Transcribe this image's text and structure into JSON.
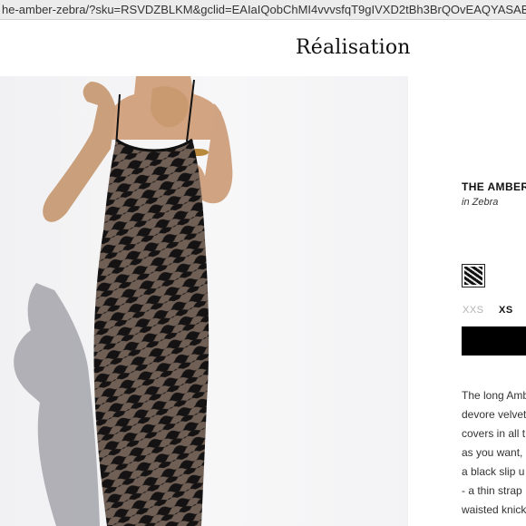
{
  "browser": {
    "url": "he-amber-zebra/?sku=RSVDZBLKM&gclid=EAIaIQobChMI4vvvsfqT9gIVXD2tBh3BrQOvEAQYASAB"
  },
  "header": {
    "logo": "Réalisation"
  },
  "product": {
    "title": "THE AMBER",
    "subtitle": "in Zebra",
    "swatch_icon": "zebra-swatch",
    "sizes": [
      "XXS",
      "XS"
    ],
    "selected_size": "XS",
    "description_lines": [
      "The long Amb",
      "devore velvet",
      "covers in all t",
      "as you want, '",
      "a black slip u",
      "- a thin strap",
      "waisted knick"
    ]
  },
  "colors": {
    "accent": "#000000",
    "muted_size": "#b3b3b3",
    "url_bar": "#ececec"
  }
}
